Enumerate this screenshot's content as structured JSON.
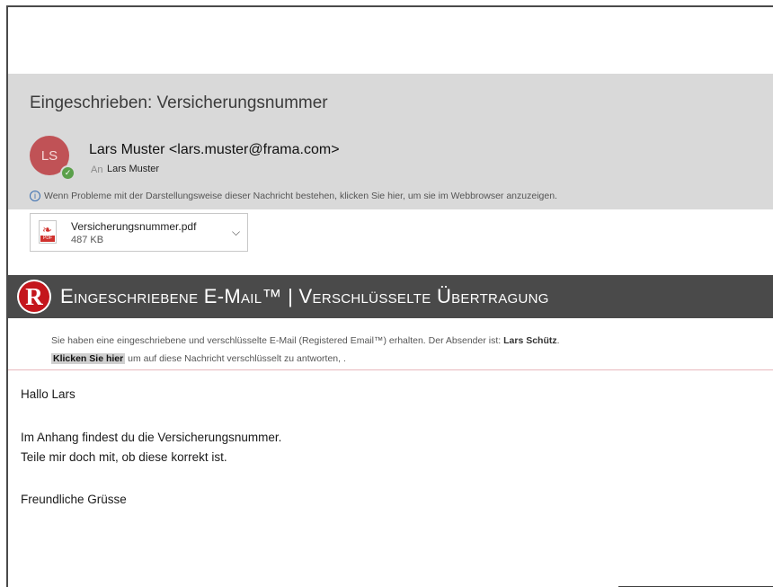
{
  "email": {
    "subject": "Eingeschrieben: Versicherungsnummer",
    "avatar_initials": "LS",
    "sender": "Lars Muster <lars.muster@frama.com>",
    "to_label": "An",
    "to_value": "Lars Muster",
    "info_text": "Wenn Probleme mit der Darstellungsweise dieser Nachricht bestehen, klicken Sie hier, um sie im Webbrowser anzuzeigen.",
    "attachment": {
      "name": "Versicherungsnummer.pdf",
      "size": "487 KB",
      "icon_tag": "PDF"
    }
  },
  "banner": {
    "logo_letter": "R",
    "title": "Eingeschriebene E-Mail™ | Verschlüsselte Übertragung",
    "notice_text": "Sie haben eine eingeschriebene und verschlüsselte E-Mail (Registered Email™) erhalten. Der Absender ist: ",
    "sender_name": "Lars Schütz",
    "notice_end": ".",
    "reply_link": "Klicken Sie hier",
    "reply_rest": " um auf diese Nachricht verschlüsselt zu antworten, ."
  },
  "message": {
    "greeting": "Hallo Lars",
    "line1": "Im Anhang findest du die Versicherungsnummer.",
    "line2": "Teile mir doch mit, ob diese korrekt ist.",
    "closing": "Freundliche Grüsse"
  },
  "colors": {
    "header_bg": "#d9d9d9",
    "avatar_bg": "#c05256",
    "banner_bg": "#4a4a4a",
    "logo_red": "#c4161c",
    "presence_green": "#5aa04a"
  }
}
